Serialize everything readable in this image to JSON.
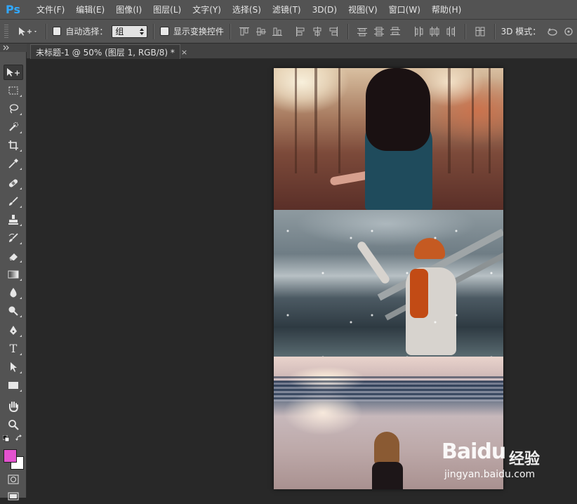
{
  "app": {
    "logo": "Ps"
  },
  "menu": [
    "文件(F)",
    "编辑(E)",
    "图像(I)",
    "图层(L)",
    "文字(Y)",
    "选择(S)",
    "滤镜(T)",
    "3D(D)",
    "视图(V)",
    "窗口(W)",
    "帮助(H)"
  ],
  "options_bar": {
    "auto_select_label": "自动选择：",
    "auto_select_value": "组",
    "show_transform_label": "显示变换控件",
    "mode_3d_label": "3D 模式："
  },
  "document": {
    "tab_title": "未标题-1 @ 50% (图层 1, RGB/8) *",
    "close_glyph": "×"
  },
  "tools": [
    "move-tool",
    "rectangular-marquee-tool",
    "lasso-tool",
    "quick-selection-tool",
    "crop-tool",
    "eyedropper-tool",
    "spot-healing-brush-tool",
    "brush-tool",
    "clone-stamp-tool",
    "history-brush-tool",
    "eraser-tool",
    "gradient-tool",
    "blur-tool",
    "dodge-tool",
    "pen-tool",
    "type-tool",
    "path-selection-tool",
    "rectangle-tool",
    "hand-tool",
    "zoom-tool"
  ],
  "type_tool_glyph": "T",
  "colors": {
    "foreground": "#e352cf",
    "background": "#ffffff",
    "ui_panel": "#535353",
    "canvas_bg": "#282828"
  },
  "watermark": {
    "logo": "Bai",
    "logo_paw": "du",
    "cn": "经验",
    "url": "jingyan.baidu.com"
  }
}
